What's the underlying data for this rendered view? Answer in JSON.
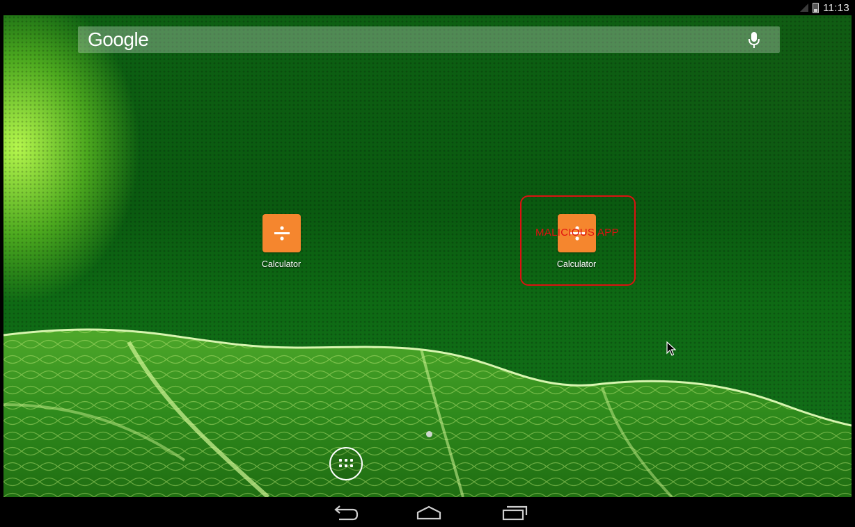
{
  "status_bar": {
    "time": "11:13",
    "icons": [
      "signal-icon",
      "battery-icon"
    ]
  },
  "search": {
    "logo_text": "Google",
    "icon": "mic-icon"
  },
  "apps": [
    {
      "label": "Calculator",
      "icon": "calculator-icon",
      "color": "#f5862e"
    },
    {
      "label": "Calculator",
      "icon": "calculator-icon",
      "color": "#f5862e"
    }
  ],
  "annotation": {
    "text": "MALICIOUS APP",
    "color": "#e01010"
  },
  "dock": {
    "icon": "app-drawer-icon"
  },
  "nav": {
    "buttons": [
      "back-icon",
      "home-icon",
      "recents-icon"
    ]
  }
}
